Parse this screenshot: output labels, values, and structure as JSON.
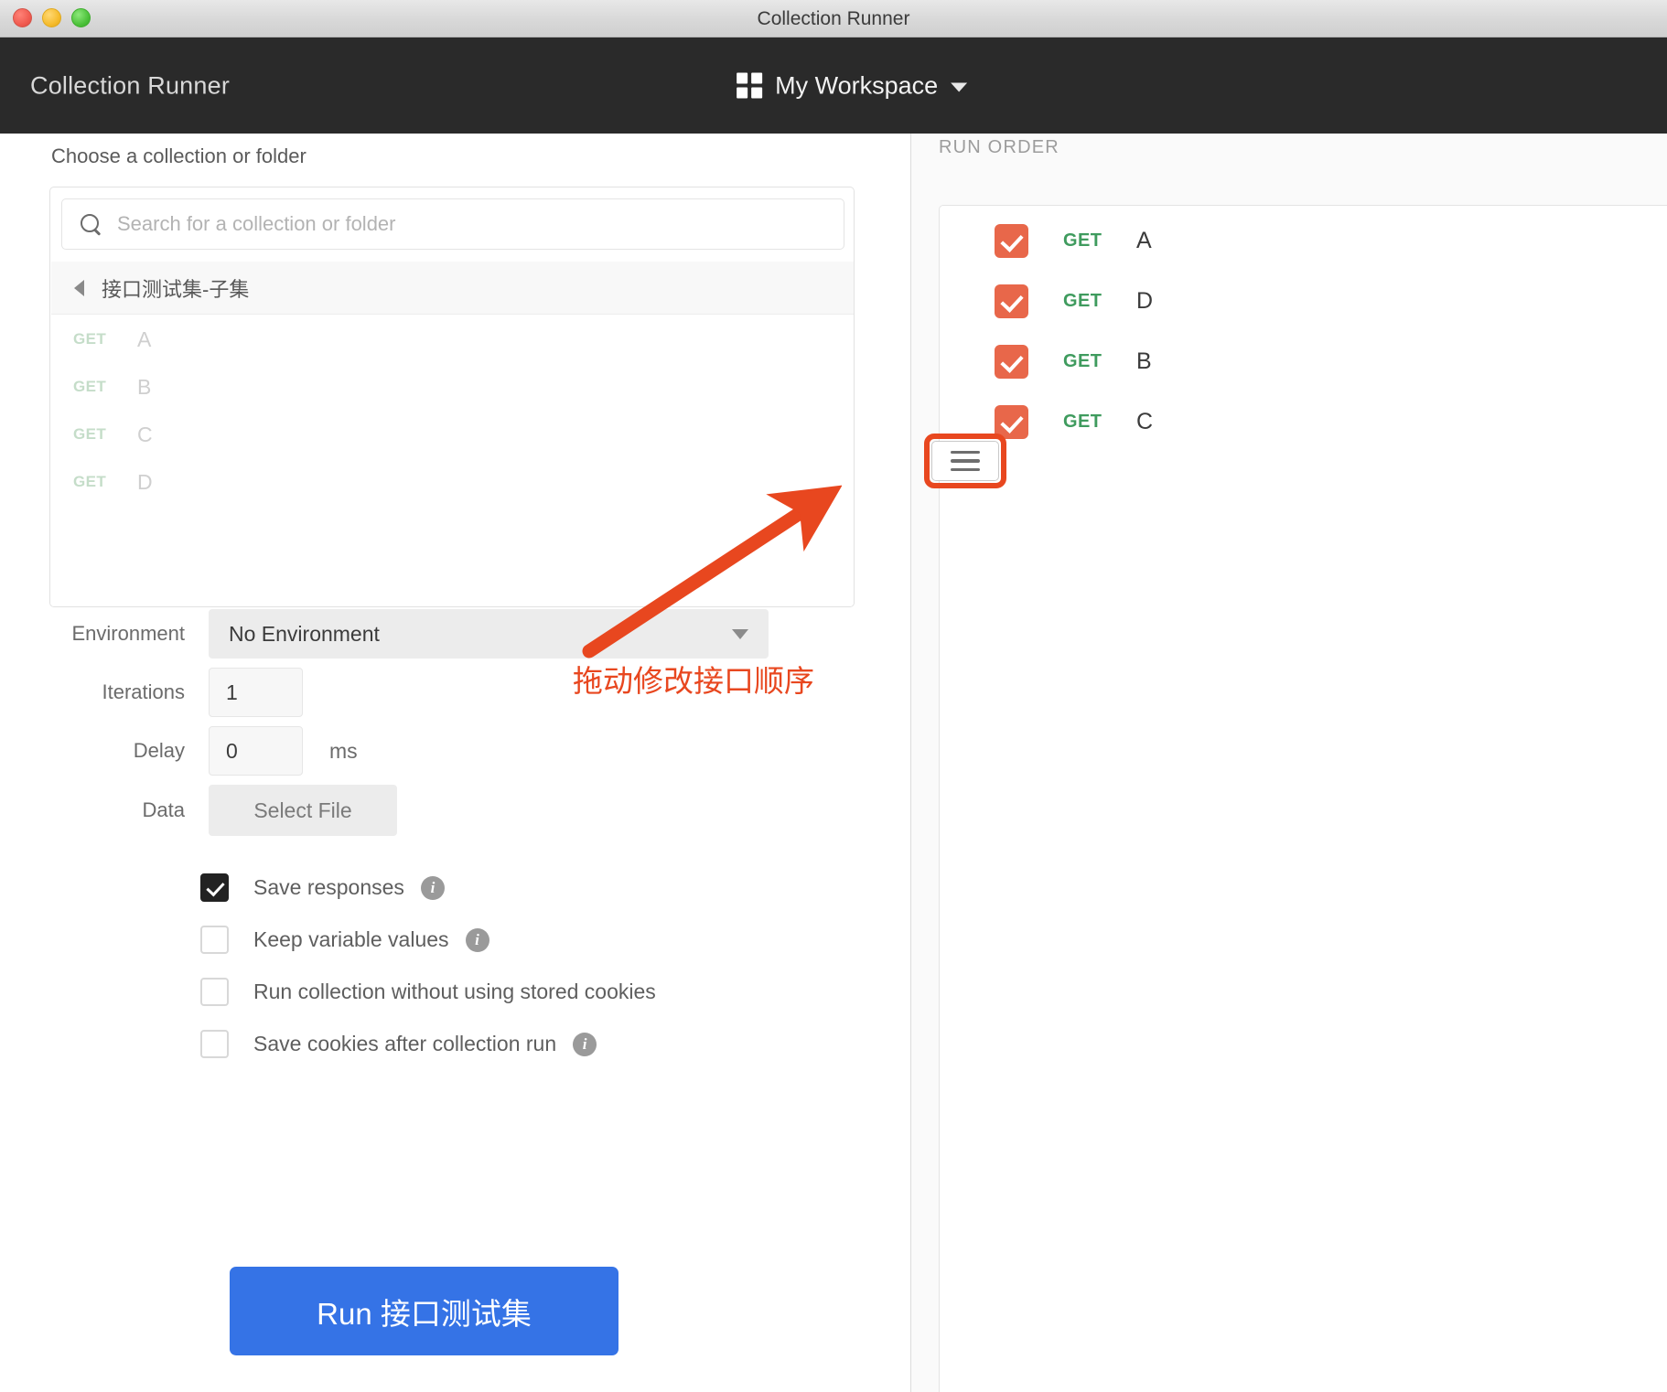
{
  "window": {
    "title": "Collection Runner",
    "traffic_lights": [
      "close-red",
      "minimize-yellow",
      "zoom-green"
    ]
  },
  "header": {
    "app_name": "Collection Runner",
    "workspace_icon": "grid-icon",
    "workspace_label": "My Workspace",
    "workspace_caret": "chevron-down-icon"
  },
  "left": {
    "choose_label": "Choose a collection or folder",
    "search": {
      "icon": "search-icon",
      "placeholder": "Search for a collection or folder",
      "value": ""
    },
    "breadcrumb": {
      "back_icon": "triangle-left-icon",
      "label": "接口测试集-子集"
    },
    "requests": [
      {
        "method": "GET",
        "name": "A"
      },
      {
        "method": "GET",
        "name": "B"
      },
      {
        "method": "GET",
        "name": "C"
      },
      {
        "method": "GET",
        "name": "D"
      }
    ],
    "form": {
      "environment_label": "Environment",
      "environment_value": "No Environment",
      "iterations_label": "Iterations",
      "iterations_value": "1",
      "delay_label": "Delay",
      "delay_value": "0",
      "delay_unit": "ms",
      "data_label": "Data",
      "select_file_label": "Select File"
    },
    "checkboxes": [
      {
        "label": "Save responses",
        "checked": true,
        "info": "i"
      },
      {
        "label": "Keep variable values",
        "checked": false,
        "info": "i"
      },
      {
        "label": "Run collection without using stored cookies",
        "checked": false,
        "info": ""
      },
      {
        "label": "Save cookies after collection run",
        "checked": false,
        "info": "i"
      }
    ],
    "run_button_label": "Run 接口测试集"
  },
  "right": {
    "title": "RUN ORDER",
    "rows": [
      {
        "method": "GET",
        "name": "A",
        "checked": true
      },
      {
        "method": "GET",
        "name": "D",
        "checked": true
      },
      {
        "method": "GET",
        "name": "B",
        "checked": true
      },
      {
        "method": "GET",
        "name": "C",
        "checked": true
      }
    ],
    "drag_handle_icon": "hamburger-drag-handle-icon"
  },
  "annotation": {
    "text": "拖动修改接口顺序",
    "color": "#E8471F",
    "arrow": "arrow-up-right-icon",
    "highlight_target": "drag-handle"
  },
  "colors": {
    "accent_blue": "#3573E6",
    "checkbox_orange": "#E8674A",
    "method_green": "#3F9B5E",
    "annotation_red": "#E8471F",
    "header_dark": "#2A2A2A"
  }
}
